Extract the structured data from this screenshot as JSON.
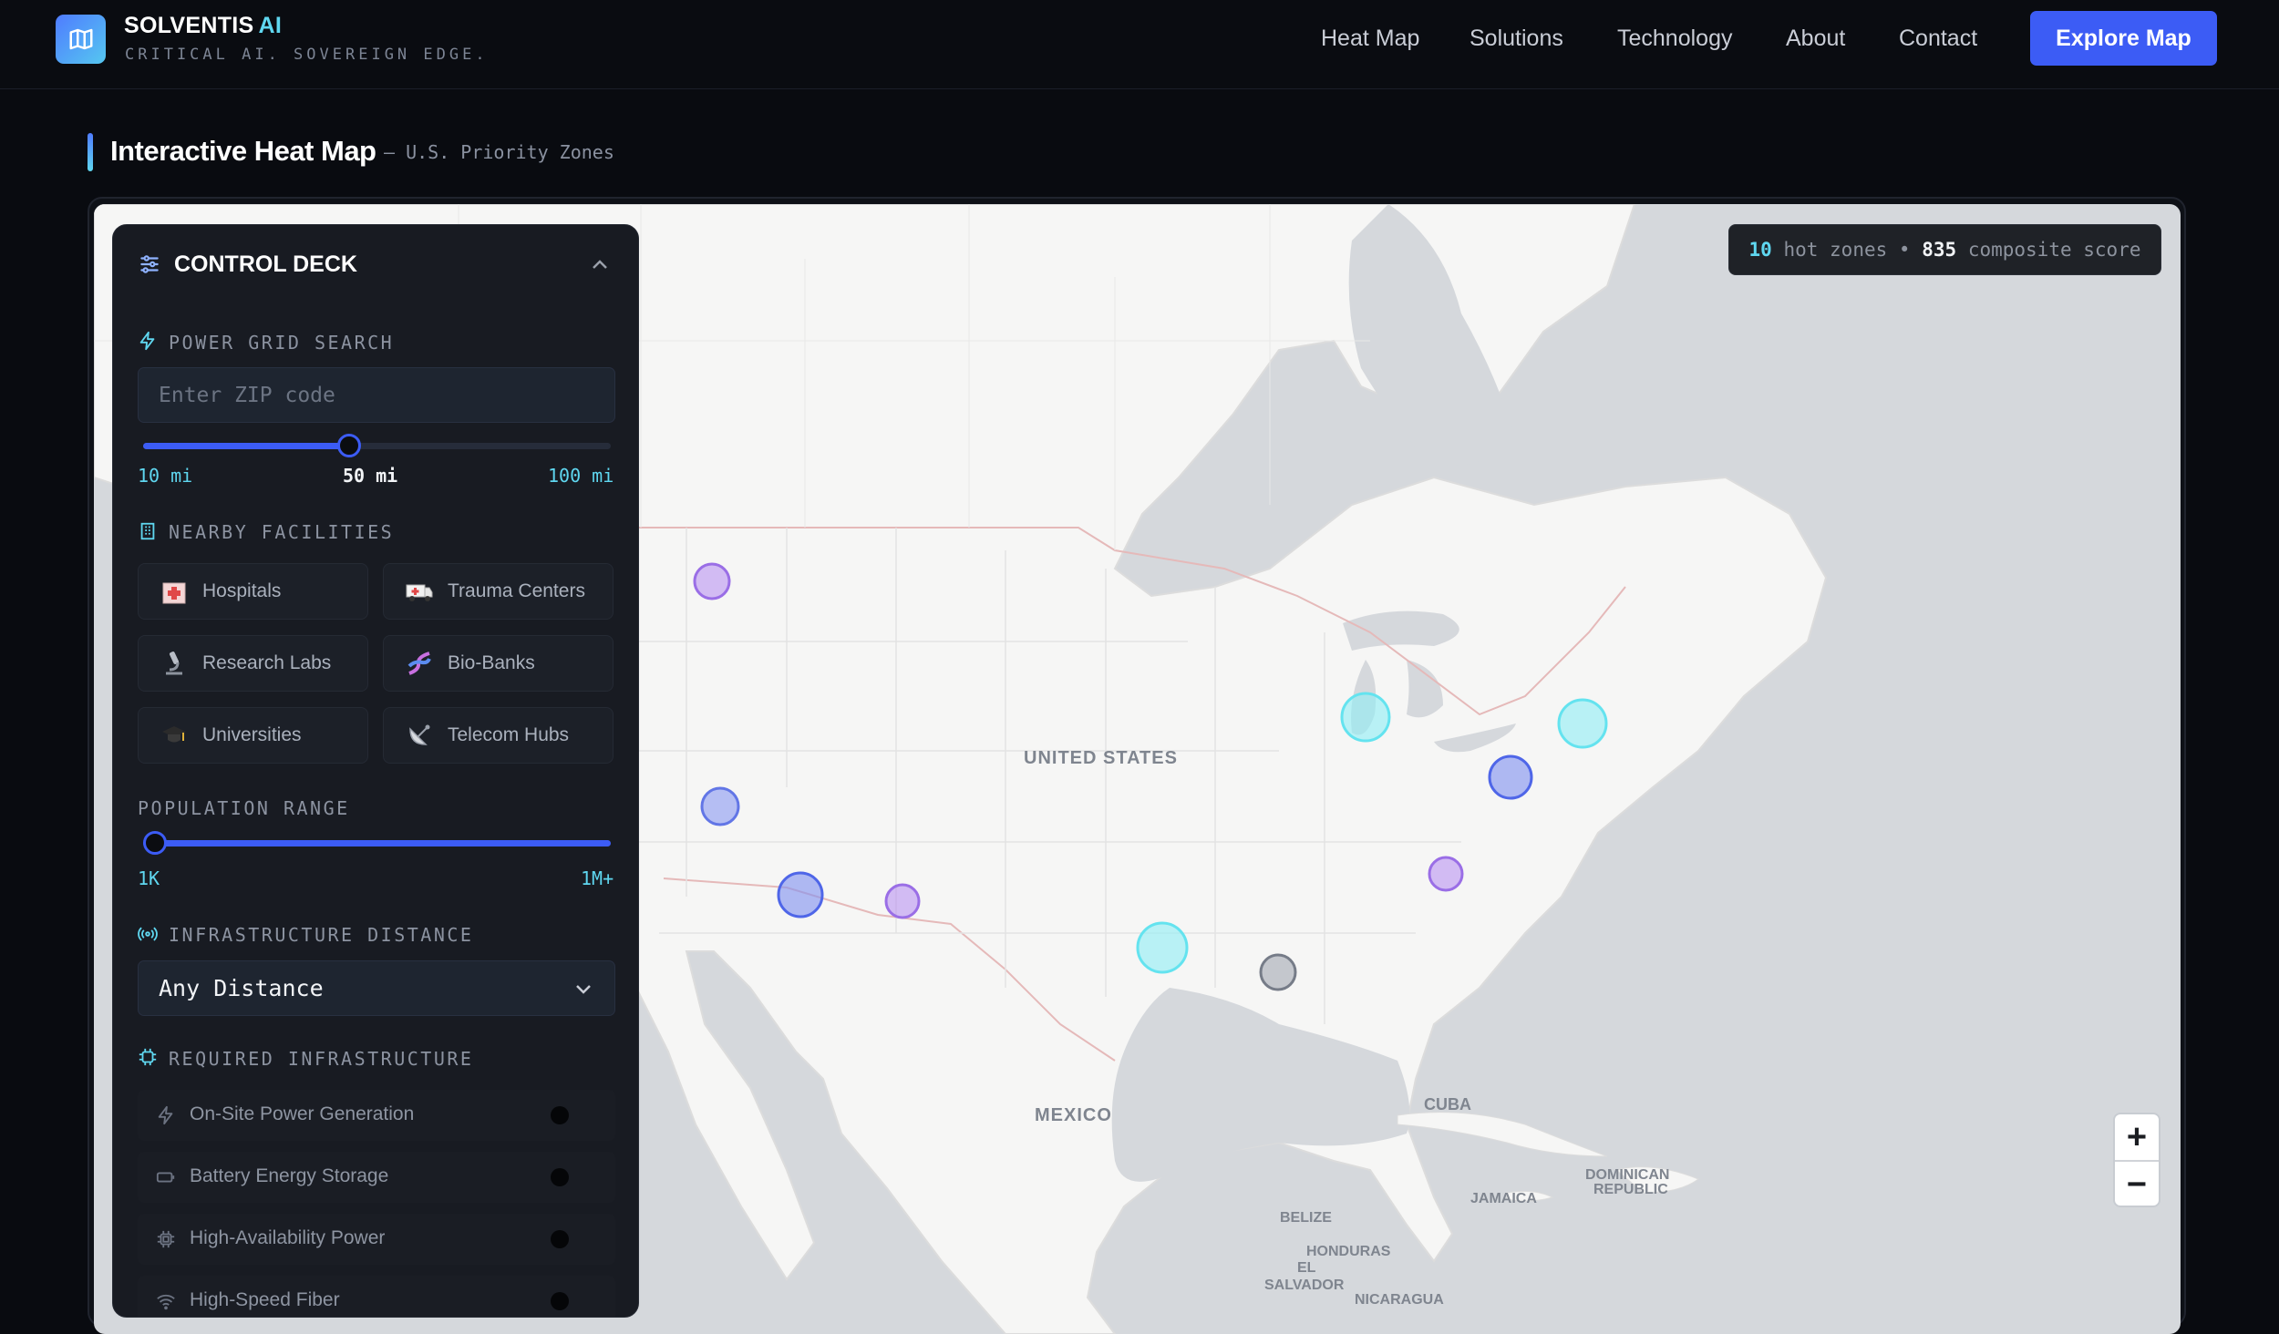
{
  "brand": {
    "name": "SOLVENTIS",
    "ai": "AI",
    "tagline": "CRITICAL AI. SOVEREIGN EDGE."
  },
  "nav": {
    "links": [
      "Heat Map",
      "Solutions",
      "Technology",
      "About",
      "Contact"
    ],
    "cta": "Explore Map"
  },
  "page": {
    "title": "Interactive Heat Map",
    "subtitle": "— U.S. Priority Zones"
  },
  "stats": {
    "hot_zones": "10",
    "hot_zones_label": "hot zones",
    "sep": "•",
    "score": "835",
    "score_label": "composite score"
  },
  "deck": {
    "title": "CONTROL DECK",
    "power": {
      "label": "POWER GRID SEARCH",
      "placeholder": "Enter ZIP code",
      "radius_value": "50 mi",
      "radius_fraction": 0.44,
      "min": "10 mi",
      "max": "100 mi"
    },
    "facilities": {
      "label": "NEARBY FACILITIES",
      "items": [
        {
          "label": "Hospitals",
          "icon": "hospital-icon"
        },
        {
          "label": "Trauma Centers",
          "icon": "ambulance-icon"
        },
        {
          "label": "Research Labs",
          "icon": "microscope-icon"
        },
        {
          "label": "Bio-Banks",
          "icon": "dna-icon"
        },
        {
          "label": "Universities",
          "icon": "graduation-cap-icon"
        },
        {
          "label": "Telecom Hubs",
          "icon": "satellite-dish-icon"
        }
      ]
    },
    "population": {
      "label": "POPULATION RANGE",
      "min": "1K",
      "max": "1M+"
    },
    "distance": {
      "label": "INFRASTRUCTURE DISTANCE",
      "value": "Any Distance"
    },
    "infrastructure": {
      "label": "REQUIRED INFRASTRUCTURE",
      "items": [
        {
          "label": "On-Site Power Generation",
          "icon": "bolt-icon"
        },
        {
          "label": "Battery Energy Storage",
          "icon": "battery-icon"
        },
        {
          "label": "High-Availability Power",
          "icon": "chip-icon"
        },
        {
          "label": "High-Speed Fiber",
          "icon": "wifi-icon"
        }
      ]
    }
  },
  "map": {
    "labels": [
      "UNITED STATES",
      "MEXICO",
      "CUBA",
      "DOMINICAN",
      "REPUBLIC",
      "JAMAICA",
      "BELIZE",
      "HONDURAS",
      "EL",
      "SALVADOR",
      "NICARAGUA"
    ],
    "colors": {
      "violet": "#b48af0",
      "blue": "#7f8ff0",
      "cyan": "#8feef5",
      "gray": "#9aa0ab"
    }
  }
}
